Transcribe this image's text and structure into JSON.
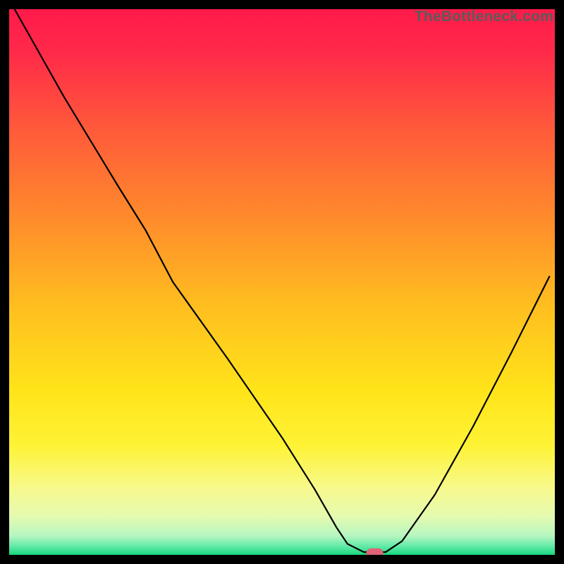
{
  "watermark": "TheBottleneck.com",
  "chart_data": {
    "type": "line",
    "title": "",
    "xlabel": "",
    "ylabel": "",
    "xlim": [
      0,
      100
    ],
    "ylim": [
      0,
      100
    ],
    "gradient_stops": [
      {
        "offset": 0,
        "color": "#ff1a4a"
      },
      {
        "offset": 0.08,
        "color": "#ff2a49"
      },
      {
        "offset": 0.22,
        "color": "#ff5a3a"
      },
      {
        "offset": 0.38,
        "color": "#ff8a2c"
      },
      {
        "offset": 0.55,
        "color": "#ffc01f"
      },
      {
        "offset": 0.7,
        "color": "#ffe41a"
      },
      {
        "offset": 0.8,
        "color": "#fef335"
      },
      {
        "offset": 0.88,
        "color": "#f7f98e"
      },
      {
        "offset": 0.93,
        "color": "#e4fbb0"
      },
      {
        "offset": 0.965,
        "color": "#b6f6c0"
      },
      {
        "offset": 0.985,
        "color": "#5fe9a6"
      },
      {
        "offset": 1.0,
        "color": "#17d77d"
      }
    ],
    "curve": [
      {
        "x": 1.0,
        "y": 100.0
      },
      {
        "x": 10.0,
        "y": 84.0
      },
      {
        "x": 20.0,
        "y": 67.5
      },
      {
        "x": 25.0,
        "y": 59.5
      },
      {
        "x": 30.0,
        "y": 50.0
      },
      {
        "x": 40.0,
        "y": 36.0
      },
      {
        "x": 50.0,
        "y": 21.5
      },
      {
        "x": 56.0,
        "y": 12.0
      },
      {
        "x": 60.0,
        "y": 5.0
      },
      {
        "x": 62.0,
        "y": 2.0
      },
      {
        "x": 65.0,
        "y": 0.5
      },
      {
        "x": 69.0,
        "y": 0.5
      },
      {
        "x": 72.0,
        "y": 2.5
      },
      {
        "x": 78.0,
        "y": 11.0
      },
      {
        "x": 85.0,
        "y": 23.5
      },
      {
        "x": 92.0,
        "y": 37.0
      },
      {
        "x": 99.0,
        "y": 51.0
      }
    ],
    "marker": {
      "x": 67.0,
      "y": 0.3,
      "color": "#e06377"
    },
    "border_color": "#000000"
  }
}
